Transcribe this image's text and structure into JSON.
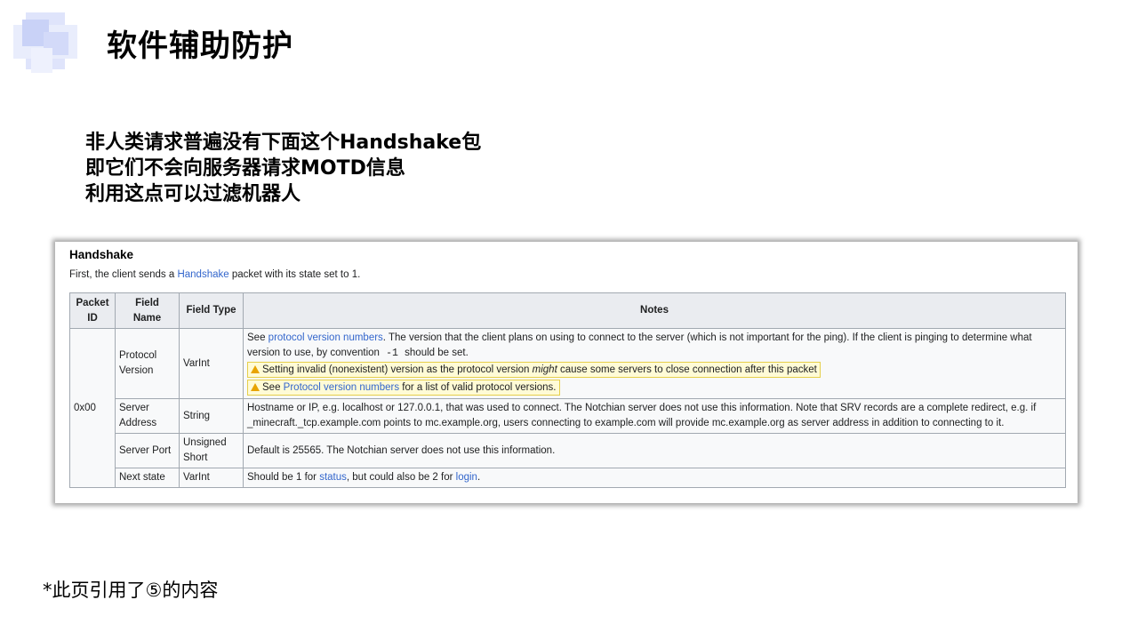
{
  "slide": {
    "title": "软件辅助防护",
    "bullets": [
      "非人类请求普遍没有下面这个Handshake包",
      "即它们不会向服务器请求MOTD信息",
      "利用这点可以过滤机器人"
    ],
    "footnote": "*此页引用了⑤的内容",
    "logo_colors": [
      "#c5cef7",
      "#dde3fb",
      "#eef1fd"
    ]
  },
  "screenshot": {
    "heading": "Handshake",
    "intro_before": "First, the client sends a ",
    "intro_link": "Handshake",
    "intro_after": " packet with its state set to 1.",
    "columns": [
      "Packet ID",
      "Field Name",
      "Field Type",
      "Notes"
    ],
    "packet_id": "0x00",
    "rows": [
      {
        "field": "Protocol Version",
        "type": "VarInt",
        "notes_prefix": "See ",
        "notes_link": "protocol version numbers",
        "notes_text": ". The version that the client plans on using to connect to the server (which is not important for the ping). If the client is pinging to determine what version to use, by convention ",
        "notes_code": "-1",
        "notes_end": " should be set.",
        "warning1_before": "Setting invalid (nonexistent) version as the protocol version ",
        "warning1_em": "might",
        "warning1_after": " cause some servers to close connection after this packet",
        "warning2_before": "See ",
        "warning2_link": "Protocol version numbers",
        "warning2_after": " for a list of valid protocol versions."
      },
      {
        "field": "Server Address",
        "type": "String",
        "notes": "Hostname or IP, e.g. localhost or 127.0.0.1, that was used to connect. The Notchian server does not use this information. Note that SRV records are a complete redirect, e.g. if _minecraft._tcp.example.com points to mc.example.org, users connecting to example.com will provide mc.example.org as server address in addition to connecting to it."
      },
      {
        "field": "Server Port",
        "type": "Unsigned Short",
        "notes": "Default is 25565. The Notchian server does not use this information."
      },
      {
        "field": "Next state",
        "type": "VarInt",
        "notes_before": "Should be 1 for ",
        "notes_link1": "status",
        "notes_middle": ", but could also be 2 for ",
        "notes_link2": "login",
        "notes_after": "."
      }
    ]
  }
}
